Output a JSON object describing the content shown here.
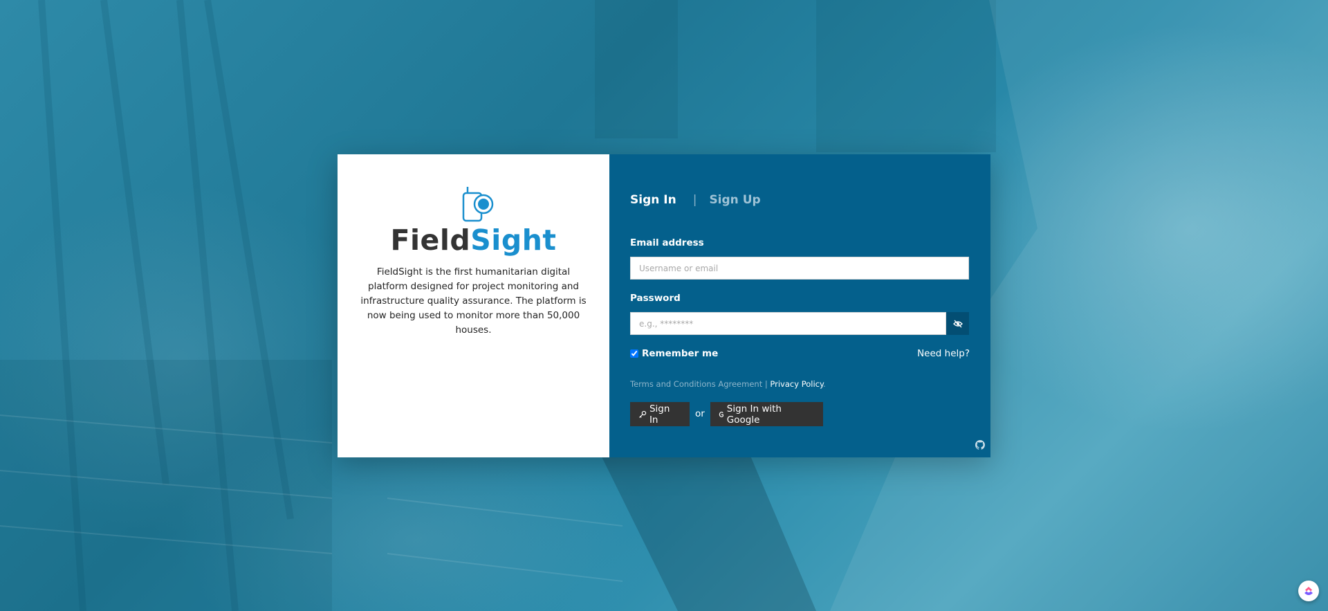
{
  "brand": {
    "name_part1": "Field",
    "name_part2": "Sight",
    "description": "FieldSight is the first humanitarian digital platform designed for project monitoring and infrastructure quality assurance. The platform is now being used to monitor more than 50,000 houses."
  },
  "tabs": {
    "sign_in": "Sign In",
    "separator": "|",
    "sign_up": "Sign Up"
  },
  "form": {
    "email_label": "Email address",
    "email_placeholder": "Username or email",
    "password_label": "Password",
    "password_placeholder": "e.g., ********",
    "remember_label": "Remember me",
    "remember_checked": true,
    "need_help": "Need help?"
  },
  "legal": {
    "terms": "Terms and Conditions Agreement",
    "separator": " | ",
    "privacy": "Privacy Policy",
    "end": "."
  },
  "actions": {
    "sign_in_button": "Sign In",
    "or": "or",
    "google_button": "Sign In with Google"
  },
  "icons": {
    "logo": "fieldsight-camera-logo",
    "eye": "eye-slash-icon",
    "key": "key-icon",
    "google": "google-g-icon",
    "github": "github-icon",
    "widget": "clickup-widget-icon"
  },
  "colors": {
    "panel_blue": "#04608c",
    "brand_blue": "#1a8fce",
    "brand_dark": "#333333",
    "button_dark": "#333333"
  }
}
